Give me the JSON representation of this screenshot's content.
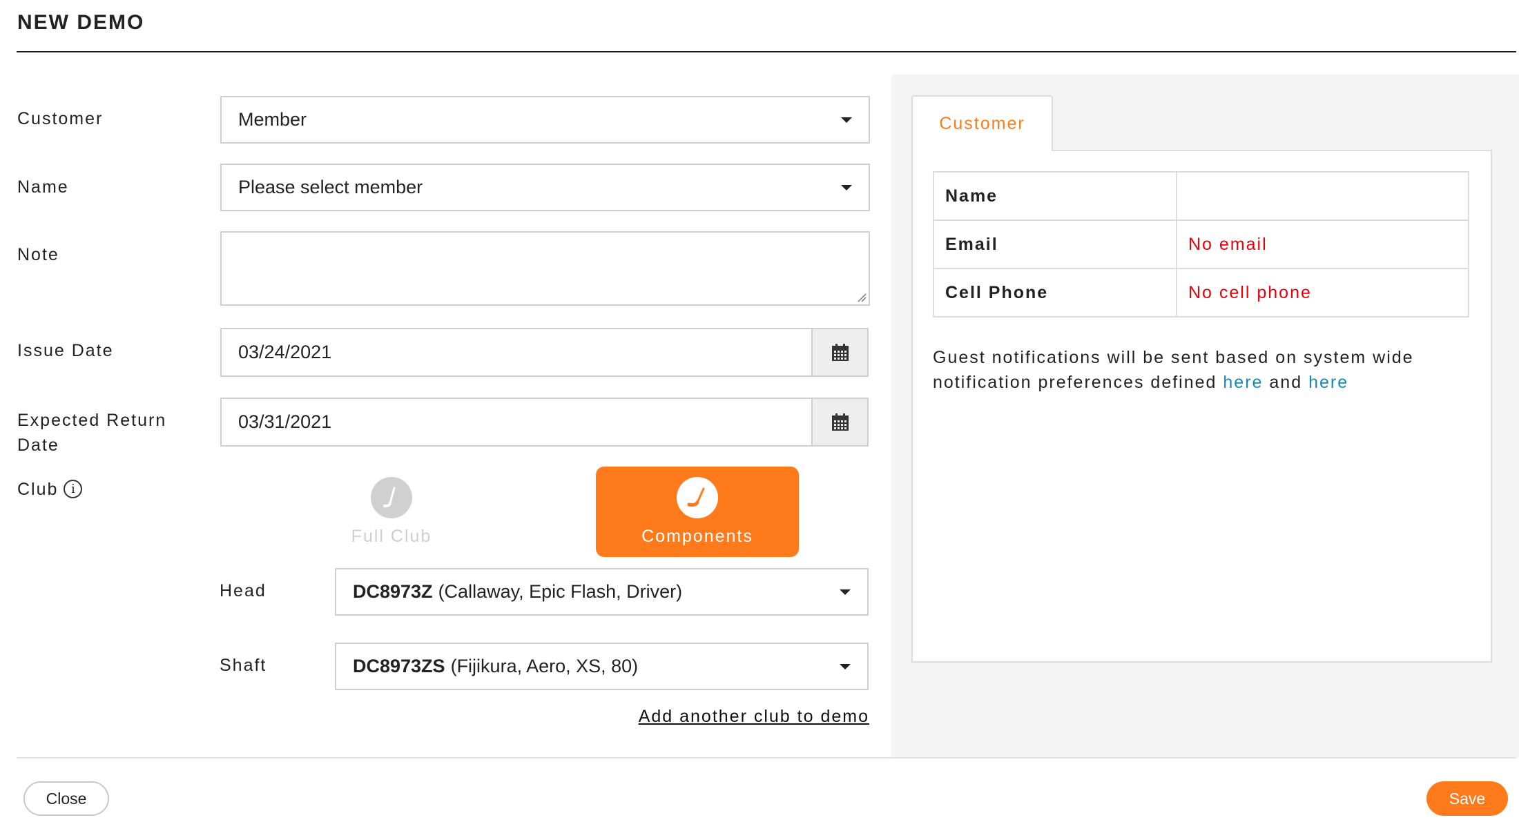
{
  "modal": {
    "title": "NEW DEMO"
  },
  "form": {
    "customer": {
      "label": "Customer",
      "value": "Member"
    },
    "name": {
      "label": "Name",
      "value": "Please select member"
    },
    "note": {
      "label": "Note",
      "value": ""
    },
    "issue_date": {
      "label": "Issue Date",
      "value": "03/24/2021",
      "icon": "calendar-icon"
    },
    "expected_return": {
      "label_line1": "Expected Return",
      "label_line2": "Date",
      "value": "03/31/2021",
      "icon": "calendar-icon"
    },
    "club": {
      "label": "Club",
      "info_icon": "i",
      "options": [
        {
          "label": "Full Club",
          "selected": false,
          "icon": "golf-club-icon"
        },
        {
          "label": "Components",
          "selected": true,
          "icon": "golf-club-icon"
        }
      ],
      "selected_color": "#ff7a1a"
    },
    "head": {
      "label": "Head",
      "code": "DC8973Z",
      "detail": "(Callaway, Epic Flash, Driver)"
    },
    "shaft": {
      "label": "Shaft",
      "code": "DC8973ZS",
      "detail": "(Fijikura, Aero, XS, 80)"
    },
    "add_club_link": "Add another club to demo"
  },
  "customer_panel": {
    "tab_label": "Customer",
    "rows": [
      {
        "key": "Name",
        "value": ""
      },
      {
        "key": "Email",
        "value": "No email"
      },
      {
        "key": "Cell Phone",
        "value": "No cell phone"
      }
    ],
    "notification": {
      "text_before": "Guest notifications will be sent based on system wide notification preferences defined ",
      "link1": "here",
      "text_mid": " and ",
      "link2": "here"
    }
  },
  "footer": {
    "close_label": "Close",
    "save_label": "Save"
  },
  "colors": {
    "accent": "#ff7a1a",
    "error": "#e8000b",
    "link": "#1689b8"
  }
}
